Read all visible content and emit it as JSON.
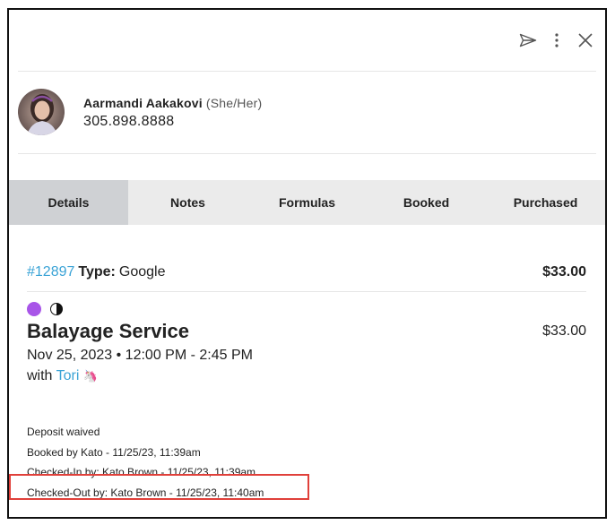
{
  "header": {
    "icons": [
      "send-icon",
      "more-vert-icon",
      "close-icon"
    ]
  },
  "client": {
    "name": "Aarmandi Aakakovi",
    "pronouns": "(She/Her)",
    "phone": "305.898.8888"
  },
  "tabs": [
    {
      "label": "Details",
      "active": true
    },
    {
      "label": "Notes",
      "active": false
    },
    {
      "label": "Formulas",
      "active": false
    },
    {
      "label": "Booked",
      "active": false
    },
    {
      "label": "Purchased",
      "active": false
    }
  ],
  "order": {
    "id": "#12897",
    "type_label": "Type:",
    "type": "Google",
    "total": "$33.00"
  },
  "service": {
    "status_colors": [
      "#a855e8"
    ],
    "title": "Balayage Service",
    "price": "$33.00",
    "datetime": "Nov 25, 2023 • 12:00 PM - 2:45 PM",
    "with_label": "with",
    "stylist": "Tori",
    "stylist_emoji": "🦄"
  },
  "history": [
    "Deposit waived",
    "Booked by Kato - 11/25/23, 11:39am",
    "Checked-In by: Kato Brown - 11/25/23, 11:39am",
    "Checked-Out by: Kato Brown - 11/25/23, 11:40am"
  ],
  "colors": {
    "link": "#3aa3d6",
    "highlight": "#e0403a",
    "active_tab": "#cfd1d4",
    "tab_bar": "#ebebeb"
  }
}
